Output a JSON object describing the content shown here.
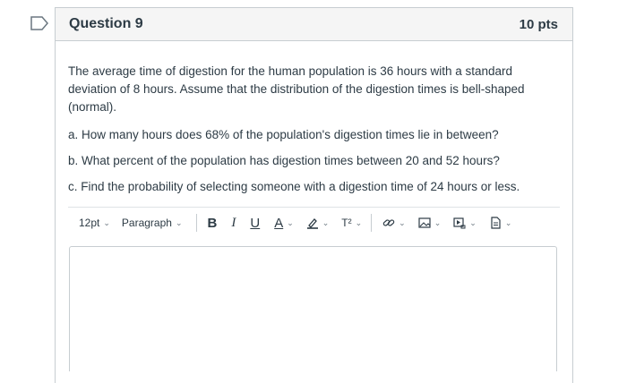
{
  "question": {
    "title": "Question 9",
    "points": "10 pts",
    "intro": "The average time of digestion for the human population is 36 hours with a standard deviation of 8 hours. Assume that the distribution of the digestion times is bell-shaped (normal).",
    "parts": [
      "a. How many hours does 68% of the population's digestion times lie in between?",
      "b. What percent of the population has digestion times between 20 and 52 hours?",
      "c. Find the probability of selecting someone with a digestion time of 24 hours or less."
    ]
  },
  "toolbar": {
    "font_size": "12pt",
    "paragraph": "Paragraph",
    "bold": "B",
    "italic": "I",
    "underline": "U",
    "text_color": "A",
    "superscript": "T²",
    "icons": [
      "link-icon",
      "image-icon",
      "media-icon",
      "document-icon"
    ]
  },
  "colors": {
    "flag_border": "#6b7780",
    "text": "#2d3b45",
    "header_bg": "#f5f5f5",
    "border": "#c7cdd1"
  }
}
